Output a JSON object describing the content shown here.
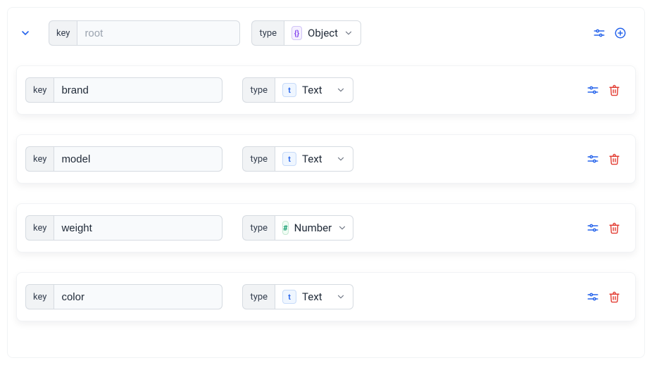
{
  "labels": {
    "key": "key",
    "type": "type"
  },
  "root": {
    "key_value": "",
    "key_placeholder": "root",
    "type_label": "Object",
    "type_badge": "{}"
  },
  "children": [
    {
      "key_value": "brand",
      "type_label": "Text",
      "type_kind": "text",
      "badge_char": "t"
    },
    {
      "key_value": "model",
      "type_label": "Text",
      "type_kind": "text",
      "badge_char": "t"
    },
    {
      "key_value": "weight",
      "type_label": "Number",
      "type_kind": "number",
      "badge_char": "#"
    },
    {
      "key_value": "color",
      "type_label": "Text",
      "type_kind": "text",
      "badge_char": "t"
    }
  ]
}
